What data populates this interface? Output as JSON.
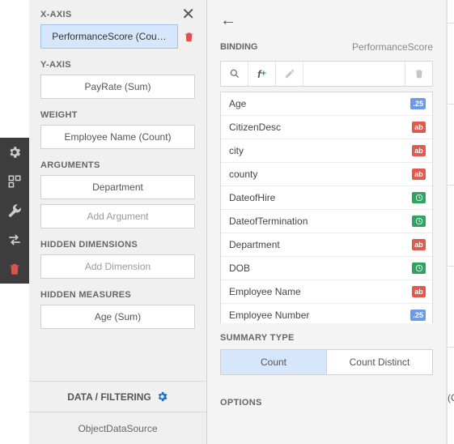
{
  "toolbar": {
    "icons": [
      "gear",
      "layout",
      "wrench",
      "swap",
      "trash"
    ]
  },
  "left": {
    "xaxis_label": "X-AXIS",
    "xaxis_value": "PerformanceScore (Cou…",
    "yaxis_label": "Y-AXIS",
    "yaxis_value": "PayRate (Sum)",
    "weight_label": "WEIGHT",
    "weight_value": "Employee Name (Count)",
    "arguments_label": "ARGUMENTS",
    "arguments_value": "Department",
    "arguments_add": "Add Argument",
    "hidden_dim_label": "HIDDEN DIMENSIONS",
    "hidden_dim_add": "Add Dimension",
    "hidden_meas_label": "HIDDEN MEASURES",
    "hidden_meas_value": "Age (Sum)",
    "footer1": "DATA / FILTERING",
    "footer2": "ObjectDataSource"
  },
  "right": {
    "binding_label": "BINDING",
    "binding_name": "PerformanceScore",
    "fields": [
      {
        "name": "Age",
        "type": "num"
      },
      {
        "name": "CitizenDesc",
        "type": "str"
      },
      {
        "name": "city",
        "type": "str"
      },
      {
        "name": "county",
        "type": "str"
      },
      {
        "name": "DateofHire",
        "type": "date"
      },
      {
        "name": "DateofTermination",
        "type": "date"
      },
      {
        "name": "Department",
        "type": "str"
      },
      {
        "name": "DOB",
        "type": "date"
      },
      {
        "name": "Employee Name",
        "type": "str"
      },
      {
        "name": "Employee Number",
        "type": "num"
      }
    ],
    "tag_num": ".25",
    "tag_str": "ab",
    "summary_label": "SUMMARY TYPE",
    "summary_opts": [
      "Count",
      "Count Distinct"
    ],
    "options_label": "OPTIONS"
  },
  "grid": {
    "corner": "(C"
  }
}
